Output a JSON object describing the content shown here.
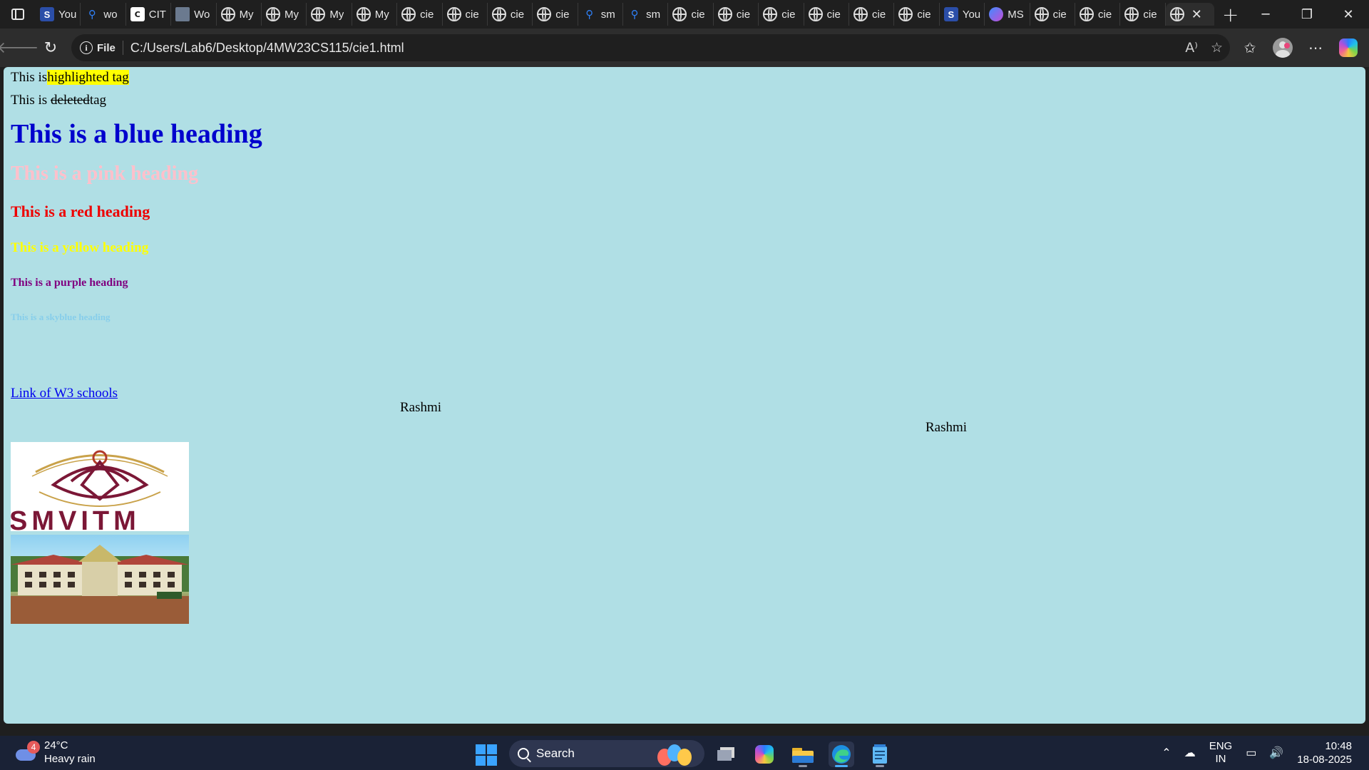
{
  "tabs": [
    {
      "title": "You",
      "icon": "s-icon"
    },
    {
      "title": "wo",
      "icon": "search-icon"
    },
    {
      "title": "CIT",
      "icon": "cit-icon"
    },
    {
      "title": "Wo",
      "icon": "doc-icon"
    },
    {
      "title": "My",
      "icon": "globe-icon"
    },
    {
      "title": "My",
      "icon": "globe-icon"
    },
    {
      "title": "My",
      "icon": "globe-icon"
    },
    {
      "title": "My",
      "icon": "globe-icon"
    },
    {
      "title": "cie",
      "icon": "globe-icon"
    },
    {
      "title": "cie",
      "icon": "globe-icon"
    },
    {
      "title": "cie",
      "icon": "globe-icon"
    },
    {
      "title": "cie",
      "icon": "globe-icon"
    },
    {
      "title": "sm",
      "icon": "search-icon"
    },
    {
      "title": "sm",
      "icon": "search-icon"
    },
    {
      "title": "cie",
      "icon": "globe-icon"
    },
    {
      "title": "cie",
      "icon": "globe-icon"
    },
    {
      "title": "cie",
      "icon": "globe-icon"
    },
    {
      "title": "cie",
      "icon": "globe-icon"
    },
    {
      "title": "cie",
      "icon": "globe-icon"
    },
    {
      "title": "cie",
      "icon": "globe-icon"
    },
    {
      "title": "You",
      "icon": "s-icon"
    },
    {
      "title": "MS",
      "icon": "ms-icon"
    },
    {
      "title": "cie",
      "icon": "globe-icon"
    },
    {
      "title": "cie",
      "icon": "globe-icon"
    },
    {
      "title": "cie",
      "icon": "globe-icon"
    }
  ],
  "address_bar": {
    "chip": "File",
    "url": "C:/Users/Lab6/Desktop/4MW23CS115/cie1.html"
  },
  "page": {
    "highlight_line": {
      "prefix": "This is",
      "highlighted": "highlighted tag"
    },
    "deleted_line": {
      "prefix": "This is ",
      "deleted": "deleted",
      "suffix": "tag"
    },
    "headings": [
      {
        "text": "This is a blue heading",
        "color": "#0000cd"
      },
      {
        "text": "This is a pink heading",
        "color": "#ffc0cb"
      },
      {
        "text": "This is a red heading",
        "color": "#ee0000"
      },
      {
        "text": "This is a yellow heading",
        "color": "#ffff00"
      },
      {
        "text": "This is a purple heading",
        "color": "#800080"
      },
      {
        "text": "This is a skyblue heading",
        "color": "#87ceeb"
      }
    ],
    "link_text": "Link of W3 schools",
    "name_1": "Rashmi",
    "name_2": "Rashmi",
    "logo_text": "SMVITM",
    "background": "#b0dfe5"
  },
  "taskbar": {
    "weather": {
      "badge": "4",
      "temp": "24°C",
      "condition": "Heavy rain"
    },
    "search_label": "Search",
    "tray": {
      "lang_1": "ENG",
      "lang_2": "IN",
      "time": "10:48",
      "date": "18-08-2025"
    }
  }
}
